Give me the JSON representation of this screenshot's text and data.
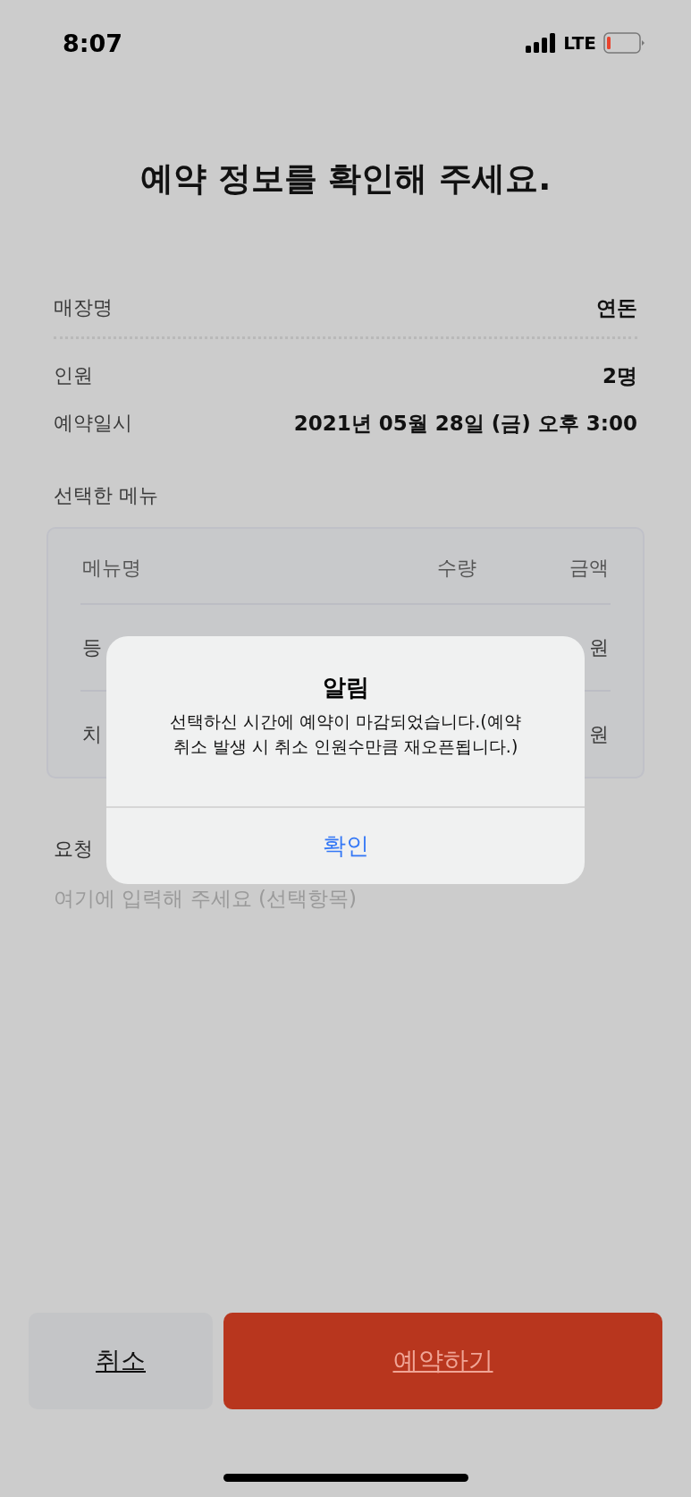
{
  "status_bar": {
    "time": "8:07",
    "network": "LTE"
  },
  "title": "예약 정보를 확인해 주세요.",
  "info_rows": [
    {
      "label": "매장명",
      "value": "연돈",
      "divider": true
    },
    {
      "label": "인원",
      "value": "2명",
      "divider": false
    },
    {
      "label": "예약일시",
      "value": "2021년 05월 28일 (금) 오후 3:00",
      "divider": false
    }
  ],
  "menu_section": {
    "label": "선택한 메뉴",
    "columns": [
      "메뉴명",
      "수량",
      "금액"
    ],
    "rows": [
      {
        "name": "등",
        "amount": "원"
      },
      {
        "name": "치",
        "amount": "원"
      }
    ]
  },
  "request": {
    "label": "요청",
    "placeholder": "여기에 입력해 주세요 (선택항목)"
  },
  "alert": {
    "title": "알림",
    "message_lines": [
      "선택하신 시간에 예약이 마감되었습니다.(예약",
      "취소 발생 시 취소 인원수만큼 재오픈됩니다.)"
    ],
    "button": "확인"
  },
  "buttons": [
    {
      "label": "취소",
      "kind": "cancel"
    },
    {
      "label": "예약하기",
      "kind": "primary"
    }
  ]
}
